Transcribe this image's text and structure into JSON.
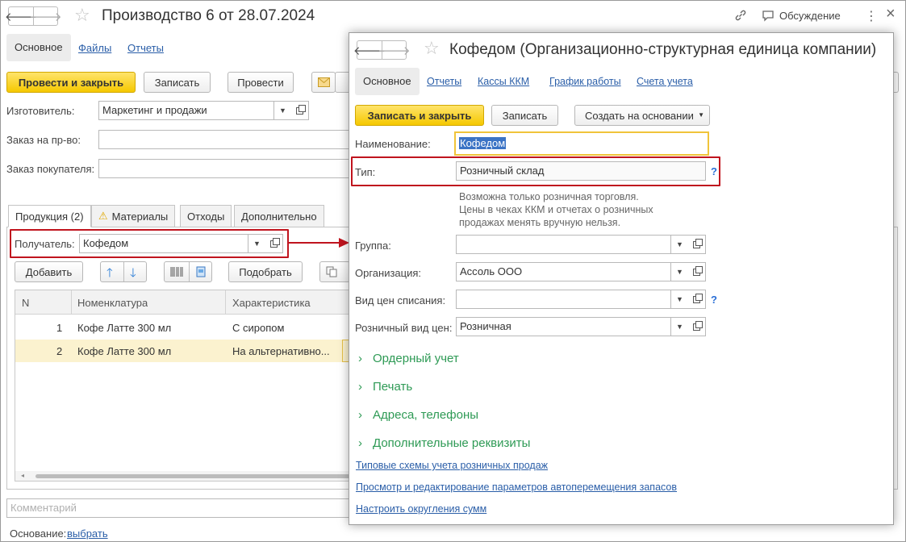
{
  "main": {
    "title": "Производство 6 от 28.07.2024",
    "header_right": {
      "discussion": "Обсуждение",
      "more": "⋮",
      "close": "×"
    },
    "tabs": [
      "Основное",
      "Файлы",
      "Отчеты"
    ],
    "toolbar": {
      "post_close": "Провести и закрыть",
      "save": "Записать",
      "post": "Провести"
    },
    "fields": {
      "manufacturer_label": "Изготовитель:",
      "manufacturer_value": "Маркетинг и продажи",
      "order_label": "Заказ на пр-во:",
      "customer_order_label": "Заказ покупателя:"
    },
    "subtabs": [
      "Продукция (2)",
      "Материалы",
      "Отходы",
      "Дополнительно"
    ],
    "recipient_label": "Получатель:",
    "recipient_value": "Кофедом",
    "table_toolbar": {
      "add": "Добавить",
      "select": "Подобрать"
    },
    "table": {
      "columns": [
        "N",
        "Номенклатура",
        "Характеристика"
      ],
      "rows": [
        {
          "n": "1",
          "item": "Кофе Латте 300 мл",
          "char": "С сиропом"
        },
        {
          "n": "2",
          "item": "Кофе Латте 300 мл",
          "char": "На альтернативно..."
        }
      ]
    },
    "comment_placeholder": "Комментарий",
    "basis_label": "Основание:",
    "basis_link": "выбрать"
  },
  "modal": {
    "title": "Кофедом (Организационно-структурная единица компании)",
    "tabs": [
      "Основное",
      "Отчеты",
      "Кассы ККМ",
      "График работы",
      "Счета учета"
    ],
    "toolbar": {
      "save_close": "Записать и закрыть",
      "save": "Записать",
      "create_based": "Создать на основании"
    },
    "name_label": "Наименование:",
    "name_value": "Кофедом",
    "type_label": "Тип:",
    "type_value": "Розничный склад",
    "type_hint": [
      "Возможна только розничная торговля.",
      "Цены в чеках ККМ и отчетах о розничных",
      "продажах менять вручную нельзя."
    ],
    "group_label": "Группа:",
    "org_label": "Организация:",
    "org_value": "Ассоль ООО",
    "write_off_price_label": "Вид цен списания:",
    "retail_price_label": "Розничный вид цен:",
    "retail_price_value": "Розничная",
    "help": "?",
    "groups": [
      "Ордерный учет",
      "Печать",
      "Адреса, телефоны",
      "Дополнительные реквизиты"
    ],
    "links": [
      "Типовые схемы учета розничных продаж",
      "Просмотр и редактирование параметров автоперемещения запасов",
      "Настроить округления сумм"
    ]
  }
}
